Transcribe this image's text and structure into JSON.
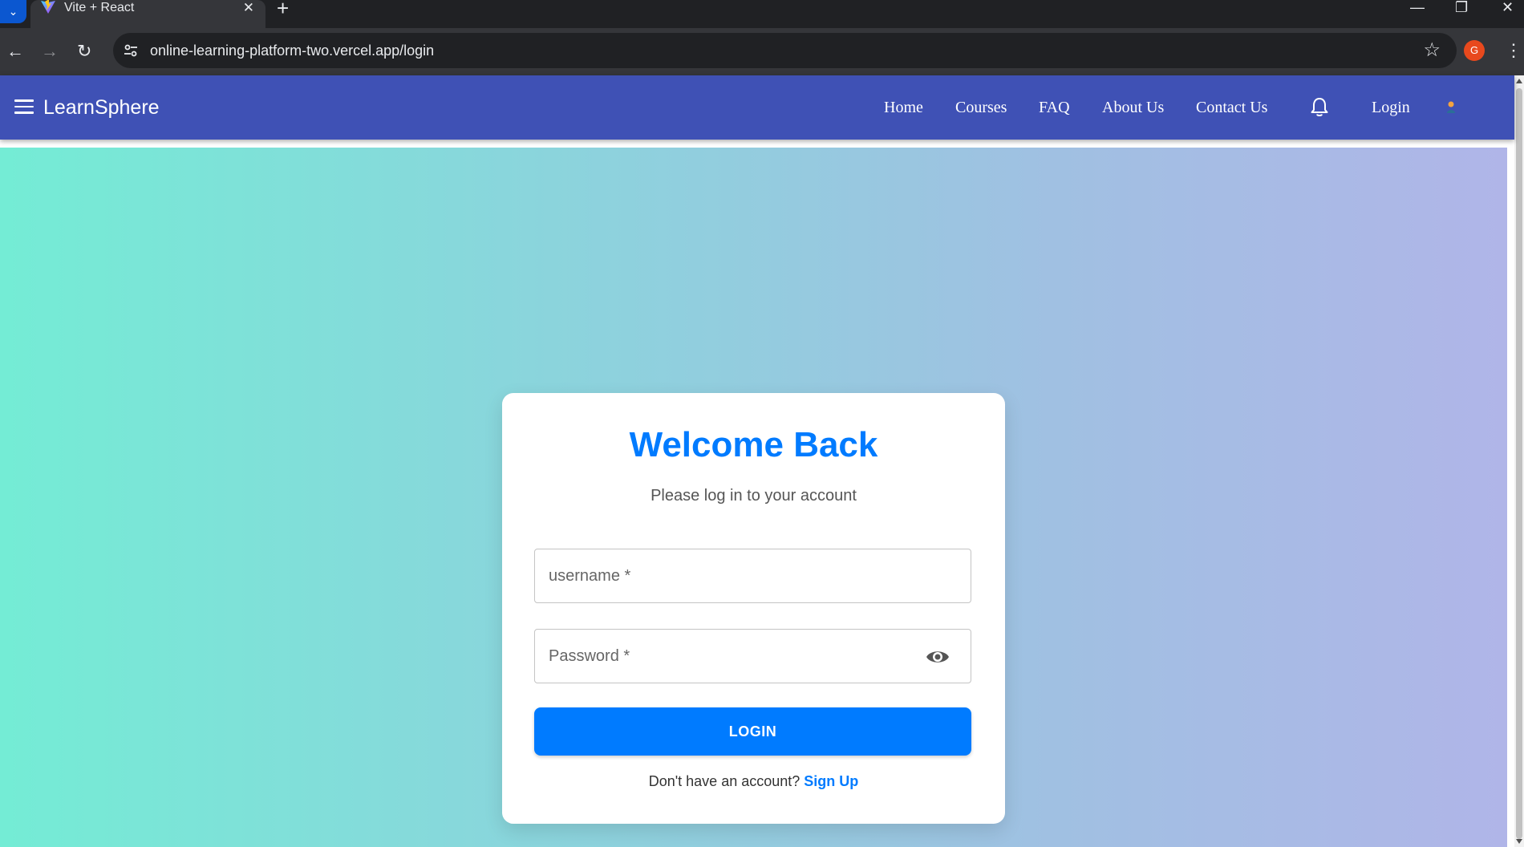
{
  "browser": {
    "tab_title": "Vite + React",
    "tab_close": "✕",
    "new_tab": "+",
    "url": "online-learning-platform-two.vercel.app/login",
    "profile_initial": "G",
    "window_controls": {
      "minimize": "—",
      "restore": "❐",
      "close": "✕"
    }
  },
  "appbar": {
    "brand": "LearnSphere",
    "nav": [
      "Home",
      "Courses",
      "FAQ",
      "About Us",
      "Contact Us"
    ],
    "login": "Login",
    "color": "#3f51b5"
  },
  "login_card": {
    "title": "Welcome Back",
    "subtitle": "Please log in to your account",
    "username_placeholder": "username *",
    "username_value": "",
    "password_placeholder": "Password *",
    "password_value": "",
    "submit_label": "LOGIN",
    "signup_prompt": "Don't have an account?",
    "signup_link": "Sign Up",
    "accent": "#007bff"
  }
}
